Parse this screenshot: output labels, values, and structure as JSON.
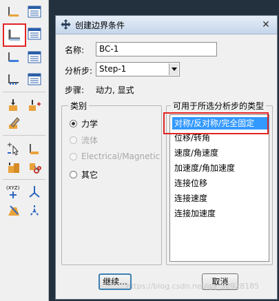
{
  "dialog": {
    "title": "创建边界条件",
    "close_glyph": "✕",
    "name_label": "名称:",
    "name_value": "BC-1",
    "step_label": "分析步:",
    "step_value": "Step-1",
    "procedure_label": "步骤:",
    "procedure_value": "动力, 显式",
    "category": {
      "title": "类别",
      "options": [
        {
          "label": "力学",
          "selected": true,
          "enabled": true
        },
        {
          "label": "流体",
          "selected": false,
          "enabled": false
        },
        {
          "label": "Electrical/Magnetic",
          "selected": false,
          "enabled": false
        },
        {
          "label": "其它",
          "selected": false,
          "enabled": true
        }
      ]
    },
    "types": {
      "title": "可用于所选分析步的类型",
      "items": [
        "对称/反对称/完全固定",
        "位移/转角",
        "速度/角速度",
        "加速度/角加速度",
        "连接位移",
        "连接速度",
        "连接加速度"
      ],
      "selected_index": 0
    },
    "continue_label": "继续...",
    "cancel_label": "取消"
  },
  "watermark": "https://blog.csdn.net/qq_32928185",
  "toolbox": {
    "icons": [
      "boundary-condition-create-icon",
      "boundary-condition-manager-icon",
      "predefined-field-icon",
      "field-manager-icon",
      "load-case-icon",
      "load-case-manager-icon",
      "load-icon",
      "load-manager-icon",
      "displacement-icon",
      "displacement-manager-icon",
      "edit-icon",
      "select-icon",
      "constraint-icon",
      "connector-icon",
      "cut-icon",
      "coordinate-system-icon",
      "axis-icon",
      "partition-icon",
      "datum-icon"
    ]
  },
  "colors": {
    "highlight": "#3399ff",
    "annotation": "#e32222"
  }
}
